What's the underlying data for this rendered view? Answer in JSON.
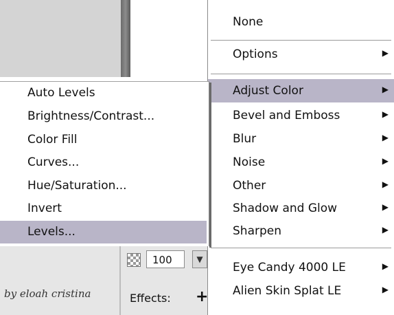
{
  "main_menu": {
    "items": [
      {
        "label": "None",
        "has_submenu": false
      },
      {
        "label": "Options",
        "has_submenu": true
      },
      {
        "label": "Adjust Color",
        "has_submenu": true,
        "highlighted": true
      },
      {
        "label": "Bevel and Emboss",
        "has_submenu": true
      },
      {
        "label": "Blur",
        "has_submenu": true
      },
      {
        "label": "Noise",
        "has_submenu": true
      },
      {
        "label": "Other",
        "has_submenu": true
      },
      {
        "label": "Shadow and Glow",
        "has_submenu": true
      },
      {
        "label": "Sharpen",
        "has_submenu": true
      },
      {
        "label": "Eye Candy 4000 LE",
        "has_submenu": true
      },
      {
        "label": "Alien Skin Splat LE",
        "has_submenu": true
      }
    ],
    "arrow_glyph": "▶"
  },
  "sub_menu": {
    "items": [
      {
        "label": "Auto Levels"
      },
      {
        "label": "Brightness/Contrast..."
      },
      {
        "label": "Color Fill"
      },
      {
        "label": "Curves..."
      },
      {
        "label": "Hue/Saturation..."
      },
      {
        "label": "Invert"
      },
      {
        "label": "Levels...",
        "highlighted": true
      }
    ]
  },
  "panel": {
    "opacity_value": "100",
    "dropdown_glyph": "▼",
    "effects_label": "Effects:",
    "add_glyph": "+"
  },
  "signature": "by eloah cristina",
  "colors": {
    "highlight": "#b9b5c8",
    "menu_bg": "#ffffff",
    "panel_bg": "#e6e6e6"
  }
}
